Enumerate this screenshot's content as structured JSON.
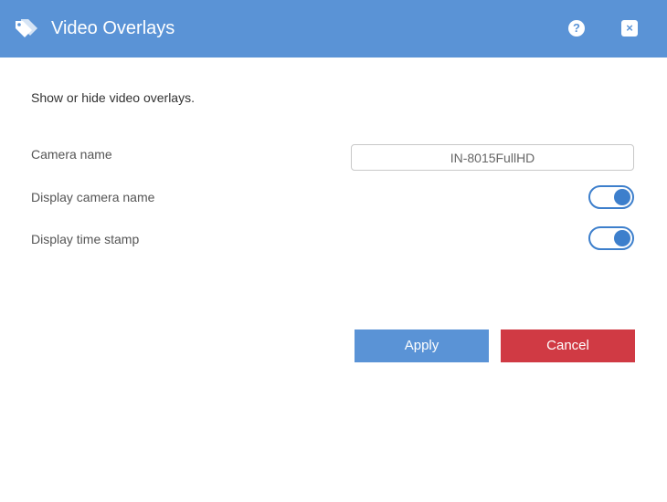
{
  "header": {
    "title": "Video Overlays",
    "help_glyph": "?",
    "close_glyph": "×",
    "background_color": "#5a93d6",
    "icons": [
      "tag-icon",
      "help-icon",
      "close-icon"
    ]
  },
  "intro_text": "Show or hide video overlays.",
  "fields": {
    "camera_name": {
      "label": "Camera name",
      "value": "IN-8015FullHD"
    },
    "display_camera_name": {
      "label": "Display camera name",
      "enabled": true
    },
    "display_time_stamp": {
      "label": "Display time stamp",
      "enabled": true
    }
  },
  "buttons": {
    "apply_label": "Apply",
    "cancel_label": "Cancel",
    "apply_color": "#5a93d6",
    "cancel_color": "#d03a44"
  },
  "accent_color": "#3d7fcc"
}
